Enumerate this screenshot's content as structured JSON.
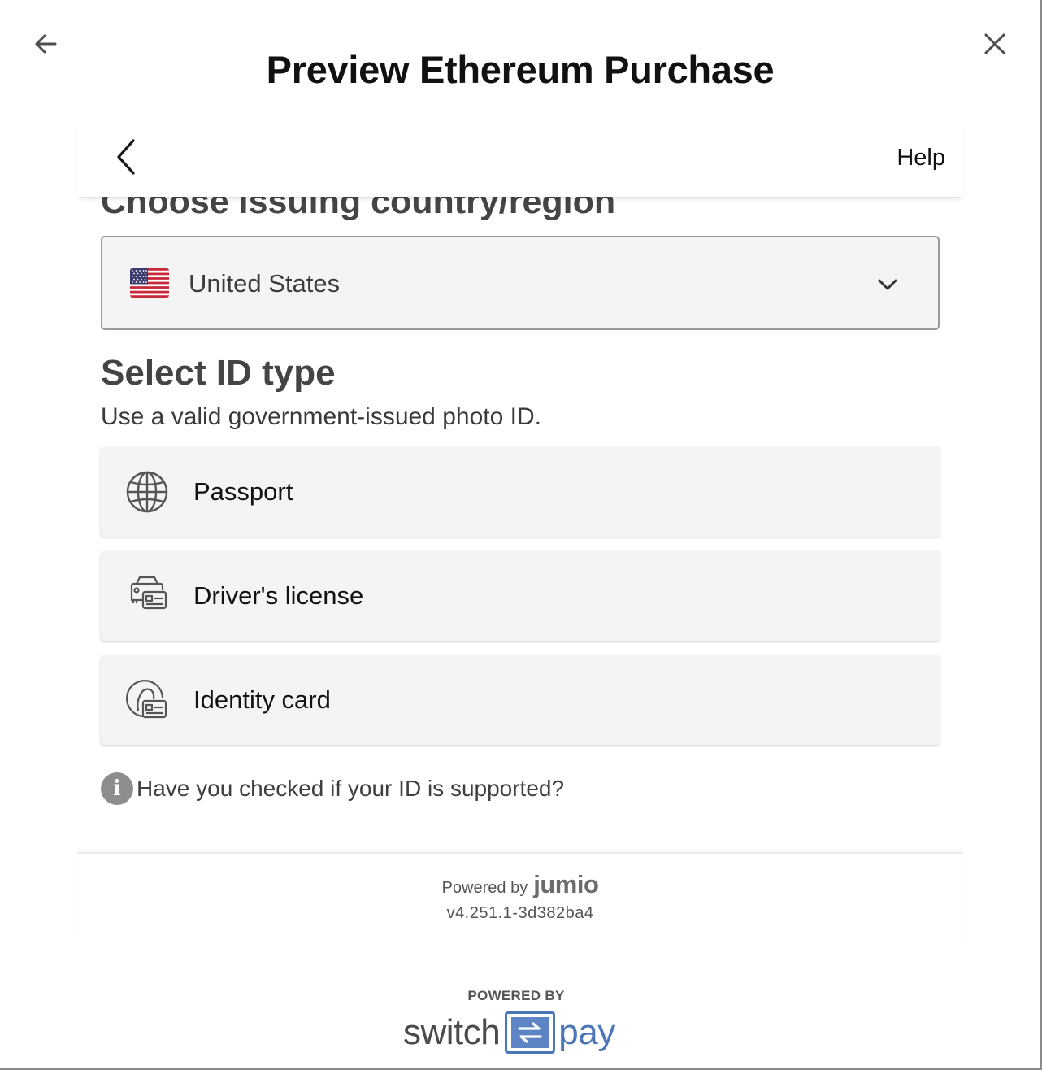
{
  "modal": {
    "title": "Preview Ethereum Purchase",
    "back_icon": "arrow-left-icon",
    "close_icon": "close-icon"
  },
  "widget": {
    "header": {
      "back_icon": "chevron-left-icon",
      "help_label": "Help"
    },
    "country": {
      "heading": "Choose issuing country/region",
      "selected": "United States",
      "flag_icon": "us-flag-icon",
      "dropdown_icon": "chevron-down-icon"
    },
    "id_type": {
      "heading": "Select ID type",
      "subtitle": "Use a valid government-issued photo ID.",
      "options": [
        {
          "label": "Passport",
          "icon": "globe-icon"
        },
        {
          "label": "Driver's license",
          "icon": "car-id-icon"
        },
        {
          "label": "Identity card",
          "icon": "person-id-icon"
        }
      ]
    },
    "hint": {
      "icon": "info-icon",
      "icon_glyph": "i",
      "text": "Have you checked if your ID is supported?"
    },
    "footer": {
      "powered_by": "Powered by",
      "brand": "jumio",
      "version": "v4.251.1-3d382ba4"
    }
  },
  "provider": {
    "caption": "POWERED BY",
    "logo_left": "switch",
    "logo_right": "pay"
  },
  "colors": {
    "brand_blue": "#4b77b8",
    "option_bg": "#f4f4f4",
    "info_gray": "#8d8d8d"
  }
}
